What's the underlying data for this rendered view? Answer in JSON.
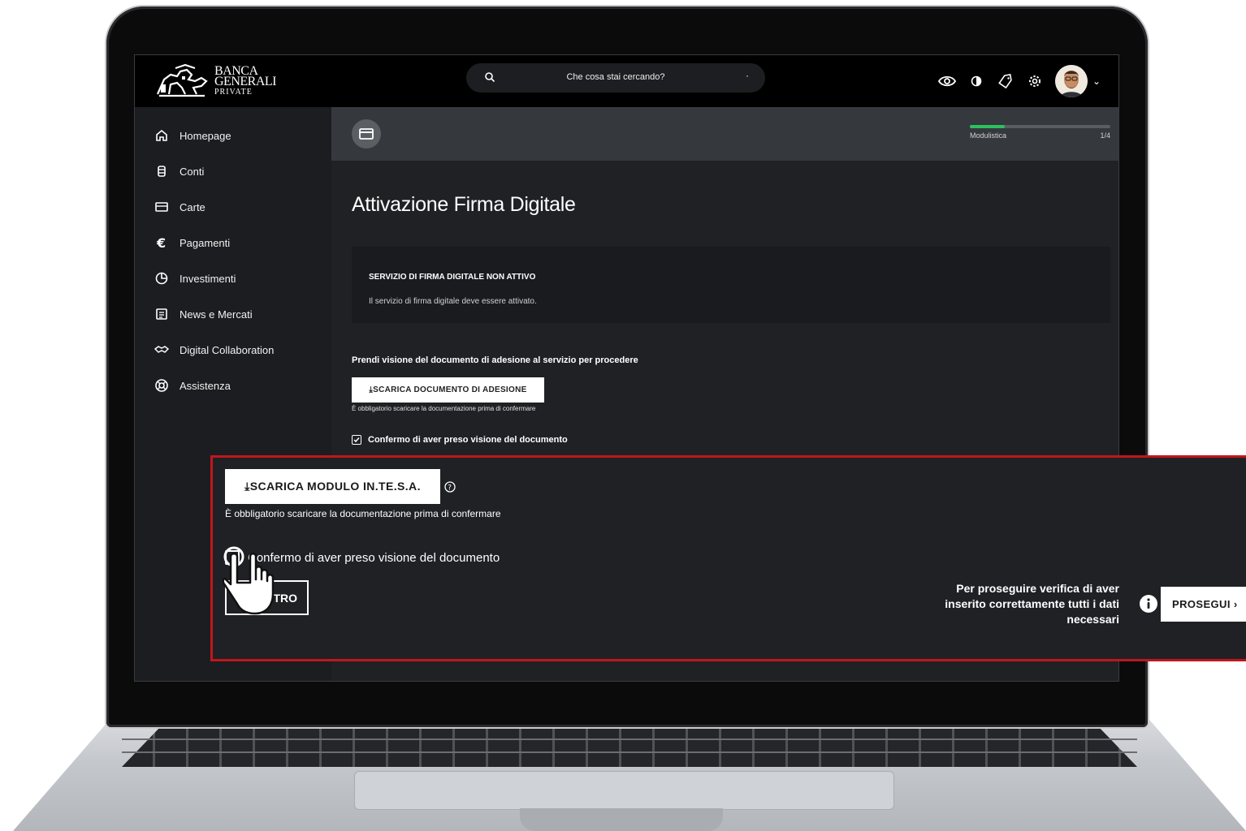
{
  "brand": {
    "line1": "BANCA",
    "line2": "GENERALI",
    "line3": "PRIVATE"
  },
  "search": {
    "placeholder": "Che cosa stai cercando?"
  },
  "sidebar": {
    "items": [
      {
        "label": "Homepage",
        "icon": "home-icon"
      },
      {
        "label": "Conti",
        "icon": "database-icon"
      },
      {
        "label": "Carte",
        "icon": "card-icon"
      },
      {
        "label": "Pagamenti",
        "icon": "euro-icon"
      },
      {
        "label": "Investimenti",
        "icon": "pie-chart-icon"
      },
      {
        "label": "News e Mercati",
        "icon": "newspaper-icon"
      },
      {
        "label": "Digital Collaboration",
        "icon": "handshake-icon"
      },
      {
        "label": "Assistenza",
        "icon": "lifebuoy-icon"
      }
    ]
  },
  "progress": {
    "label": "Modulistica",
    "step": "1/4",
    "fraction": 0.25,
    "color": "#2bc15d"
  },
  "page": {
    "title": "Attivazione Firma Digitale"
  },
  "notice": {
    "title": "SERVIZIO DI FIRMA DIGITALE NON ATTIVO",
    "text": "Il servizio di firma digitale deve essere attivato."
  },
  "adesione": {
    "instruction": "Prendi visione del documento di adesione al servizio per procedere",
    "download_label": "⤓SCARICA DOCUMENTO DI ADESIONE",
    "hint": "È obbligatorio scaricare la documentazione prima di confermare",
    "confirm_label": "Confermo di aver preso visione del documento"
  },
  "callout": {
    "border_color": "#c0161c",
    "download_label": "⤓SCARICA MODULO IN.TE.S.A.",
    "hint": "È obbligatorio scaricare la documentazione prima di confermare",
    "confirm_label": "Confermo di aver preso visione del documento",
    "back_label": "TRO",
    "verify_line1": "Per proseguire verifica di aver",
    "verify_line2": "inserito correttamente tutti i dati",
    "verify_line3": "necessari",
    "next_label": "PROSEGUI ›"
  }
}
